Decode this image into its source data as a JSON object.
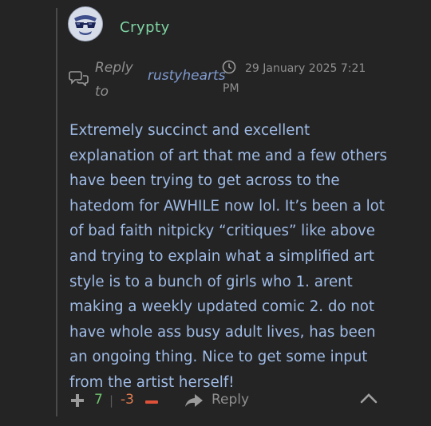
{
  "comment": {
    "author": "Crypty",
    "reply_label": "Reply to",
    "reply_target": "rustyhearts",
    "timestamp": "29 January 2025 7:21 PM",
    "body": "Extremely succinct and excellent explanation of art that me and a few others have been trying to get across to the hatedom for AWHILE now lol. It’s been a lot of bad faith nitpicky “critiques” like above and trying to explain what a simplified art style is to a bunch of girls who 1. arent making a weekly updated comic 2. do not have whole ass busy adult lives, has been an ongoing thing. Nice to get some input from the artist herself!"
  },
  "votes": {
    "up": "7",
    "divider": "|",
    "down": "-3"
  },
  "actions": {
    "reply_label": "Reply"
  },
  "icons": {
    "avatar": "sunglasses-avatar-icon",
    "reply_to": "speech-bubbles-icon",
    "time": "clock-icon",
    "upvote": "plus-icon",
    "downvote": "minus-icon",
    "reply": "share-arrow-icon",
    "collapse": "chevron-up-icon"
  },
  "colors": {
    "background": "#242424",
    "author": "#7fd4a3",
    "body_text": "#9fbbe6",
    "upvote": "#6fc46f",
    "downvote": "#e07c4f",
    "muted": "#8f8f8f"
  }
}
